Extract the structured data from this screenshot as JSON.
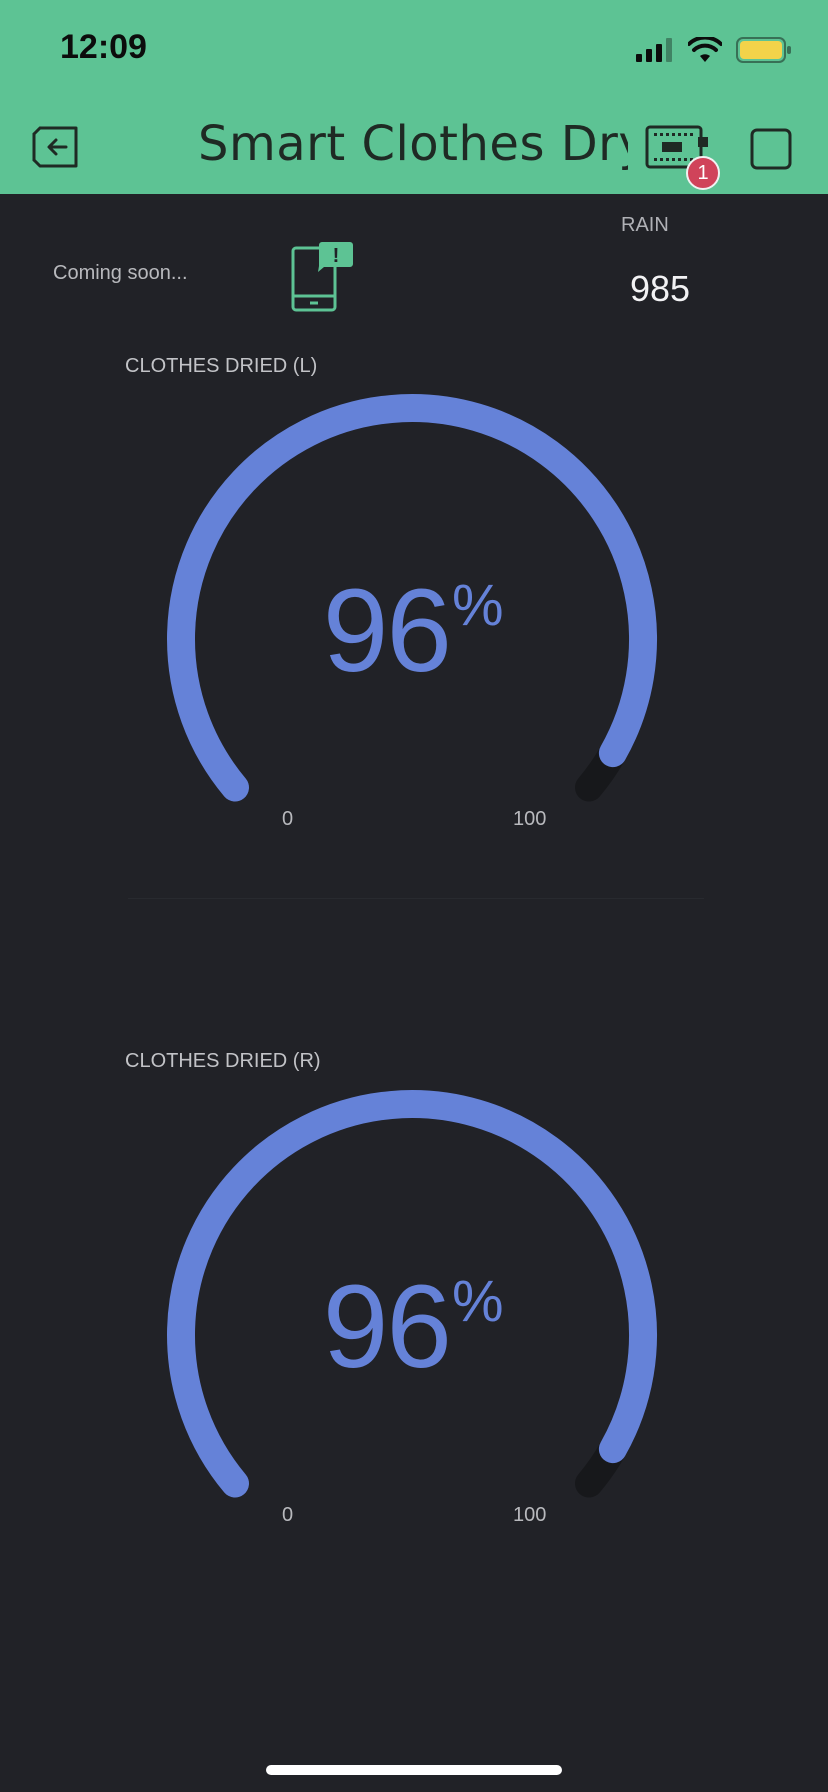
{
  "status_bar": {
    "time": "12:09"
  },
  "header": {
    "title": "Smart Clothes Drying",
    "device_badge": "1"
  },
  "widgets": {
    "notification_text": "Coming soon...",
    "rain": {
      "label": "RAIN",
      "value": "985"
    }
  },
  "gauges": [
    {
      "label": "CLOTHES DRIED (L)",
      "value": "96",
      "unit": "%",
      "min": "0",
      "max": "100",
      "level": 0.96
    },
    {
      "label": "CLOTHES DRIED (R)",
      "value": "96",
      "unit": "%",
      "min": "0",
      "max": "100",
      "level": 0.96
    }
  ],
  "colors": {
    "header_bg": "#5dc394",
    "background": "#212227",
    "gauge_fill": "#6582d8",
    "gauge_track": "#17181b",
    "badge": "#d0435a"
  },
  "icons": {
    "back": "exit-app-icon",
    "device": "hardware-device-icon",
    "stop": "stop-square-icon",
    "notification": "phone-alert-icon",
    "signal": "cellular-signal-icon",
    "wifi": "wifi-icon",
    "battery": "battery-icon"
  }
}
